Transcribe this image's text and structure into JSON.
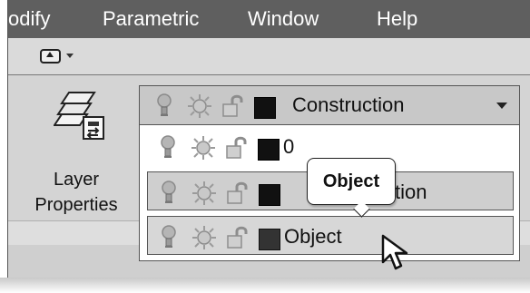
{
  "menu": {
    "items": [
      "odify",
      "Parametric",
      "Window",
      "Help"
    ]
  },
  "quick_access": {
    "icon": "view-up-icon",
    "dropdown_icon": "chevron-down-icon"
  },
  "ribbon": {
    "layer_properties": {
      "line1": "Layer",
      "line2": "Properties",
      "icon": "layer-stack-icon"
    }
  },
  "layer_dropdown": {
    "current": {
      "name": "Construction",
      "swatch": "#000000"
    },
    "rows": [
      {
        "name": "0",
        "swatch": "#000000"
      },
      {
        "name": "tion",
        "swatch": "#000000"
      },
      {
        "name": "Object",
        "swatch": "#333333"
      }
    ]
  },
  "tooltip": {
    "text": "Object"
  },
  "cursor": {
    "icon": "mouse-pointer-icon"
  },
  "colors": {
    "menu_bar": "#5f5f5f",
    "ribbon": "#d4d4d4",
    "dropdown_selected": "#c8c8c8",
    "highlight_row": "#cfcfcf"
  }
}
